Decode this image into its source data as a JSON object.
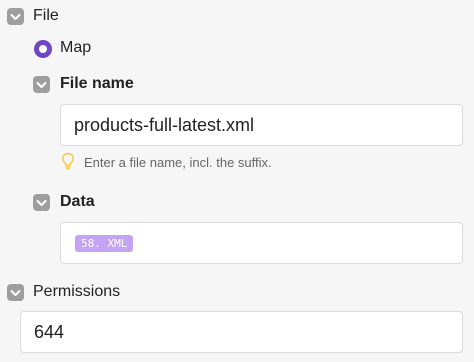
{
  "file_section": {
    "label": "File",
    "map_option": "Map"
  },
  "file_name": {
    "label": "File name",
    "value": "products-full-latest.xml",
    "hint": "Enter a file name, incl. the suffix."
  },
  "data": {
    "label": "Data",
    "pill": "58. XML"
  },
  "permissions": {
    "label": "Permissions",
    "value": "644"
  },
  "colors": {
    "accent": "#6f47c6",
    "pill": "#c4a4f2",
    "chevron": "#9e9e9e",
    "hint_bulb": "#f2c94c"
  },
  "icons": [
    "chevron-down-icon",
    "radio-selected-icon",
    "lightbulb-icon"
  ]
}
